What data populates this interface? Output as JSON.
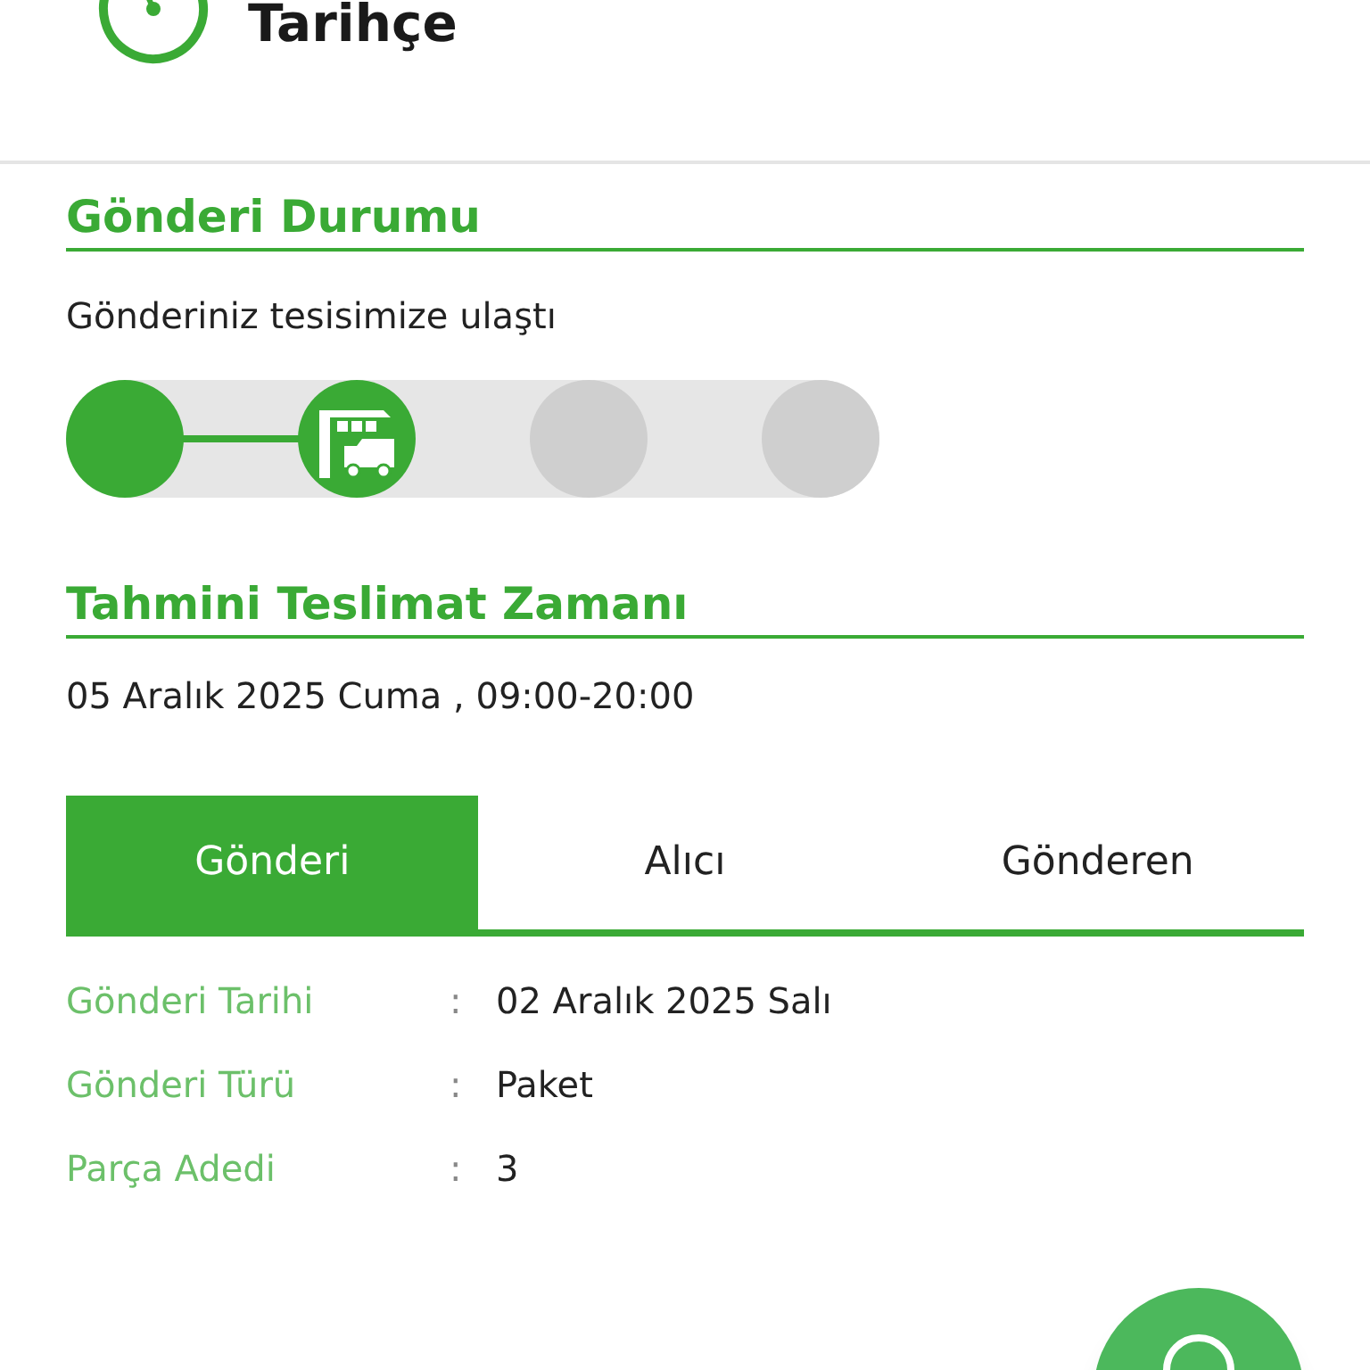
{
  "header": {
    "title": "Tarihçe"
  },
  "status": {
    "title": "Gönderi Durumu",
    "message": "Gönderiniz tesisimize ulaştı",
    "steps": [
      {
        "kind": "plain",
        "done": true
      },
      {
        "kind": "facility",
        "done": true
      },
      {
        "kind": "plain",
        "done": false
      },
      {
        "kind": "plain",
        "done": false
      }
    ]
  },
  "delivery": {
    "title": "Tahmini Teslimat Zamanı",
    "time": "05 Aralık 2025 Cuma , 09:00-20:00"
  },
  "tabs": [
    {
      "label": "Gönderi",
      "selected": true
    },
    {
      "label": "Alıcı",
      "selected": false
    },
    {
      "label": "Gönderen",
      "selected": false
    }
  ],
  "details": [
    {
      "label": "Gönderi Tarihi",
      "separator": ":",
      "value": "02 Aralık 2025 Salı"
    },
    {
      "label": "Gönderi Türü",
      "separator": ":",
      "value": "Paket"
    },
    {
      "label": "Parça Adedi",
      "separator": ":",
      "value": "3"
    }
  ]
}
